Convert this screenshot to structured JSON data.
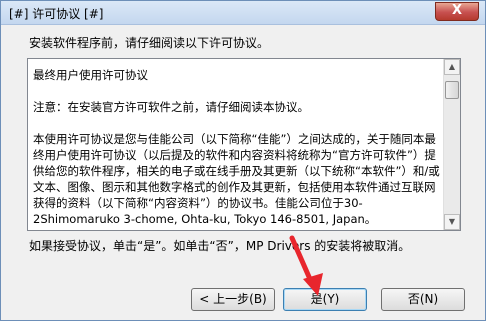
{
  "window": {
    "title": "[#] 许可协议 [#]",
    "close_symbol": "X"
  },
  "instruction": "安装软件程序前，请仔细阅读以下许可协议。",
  "license": {
    "paragraphs": [
      "最终用户使用许可协议",
      "注意：在安装官方许可软件之前，请仔细阅读本协议。",
      "本使用许可协议是您与佳能公司（以下简称“佳能”）之间达成的，关于随同本最终用户使用许可协议（以后提及的软件和内容资料将统称为“官方许可软件”）提供给您的软件程序，相关的电子或在线手册及其更新（以下统称“本软件”）和/或文本、图像、图示和其他数字格式的创作及其更新，包括使用本软件通过互联网获得的资料（以下简称“内容资料”）的协议书。佳能公司位于30-2Shimomaruko 3-chome, Ohta-ku, Tokyo 146-8501, Japan。"
    ]
  },
  "accept_text": "如果接受协议，单击“是”。如单击“否”，MP Drivers 的安装将被取消。",
  "buttons": {
    "back": "< 上一步(B)",
    "yes": "是(Y)",
    "no": "否(N)"
  },
  "annotation": {
    "arrow_color": "#e8262d"
  }
}
